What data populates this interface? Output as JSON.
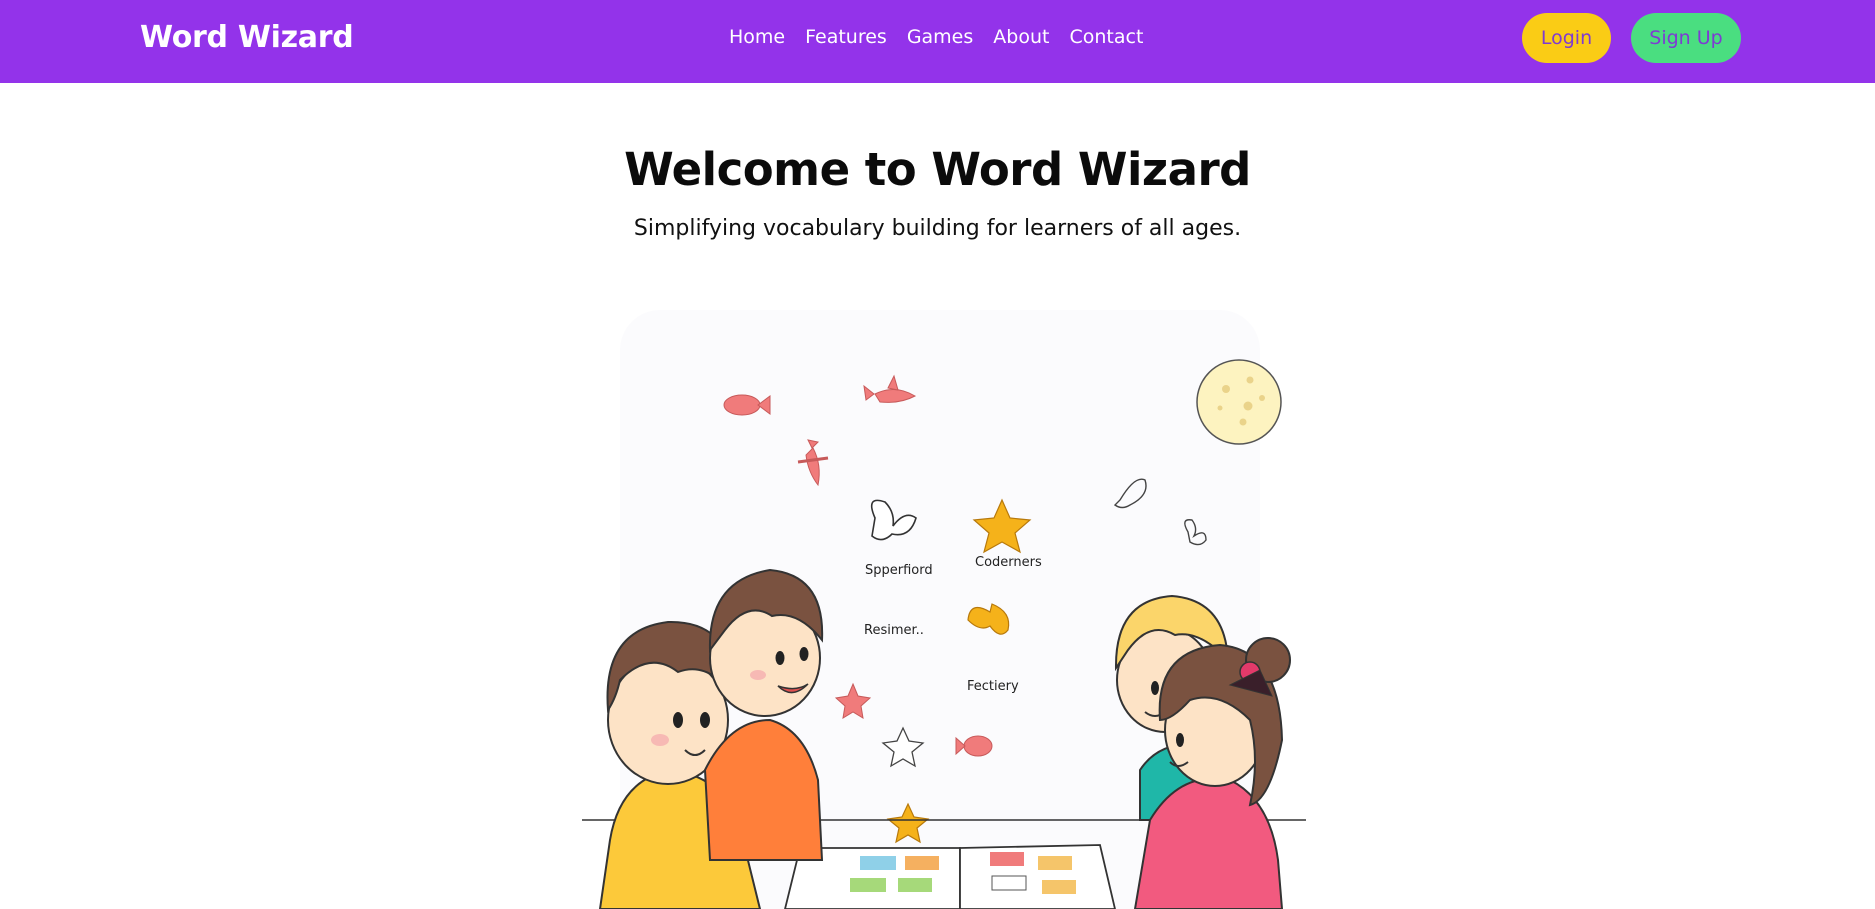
{
  "header": {
    "brand": "Word Wizard",
    "nav": [
      "Home",
      "Features",
      "Games",
      "About",
      "Contact"
    ],
    "login_label": "Login",
    "signup_label": "Sign Up"
  },
  "hero": {
    "title": "Welcome to Word Wizard",
    "subtitle": "Simplifying vocabulary building for learners of all ages."
  },
  "illustration": {
    "labels": [
      "Spperfiord",
      "Coderners",
      "Resimer..",
      "Fectiery"
    ]
  },
  "colors": {
    "header_bg": "#9333ea",
    "login_bg": "#facc15",
    "signup_bg": "#4ade80",
    "button_text": "#7e3bd3"
  }
}
